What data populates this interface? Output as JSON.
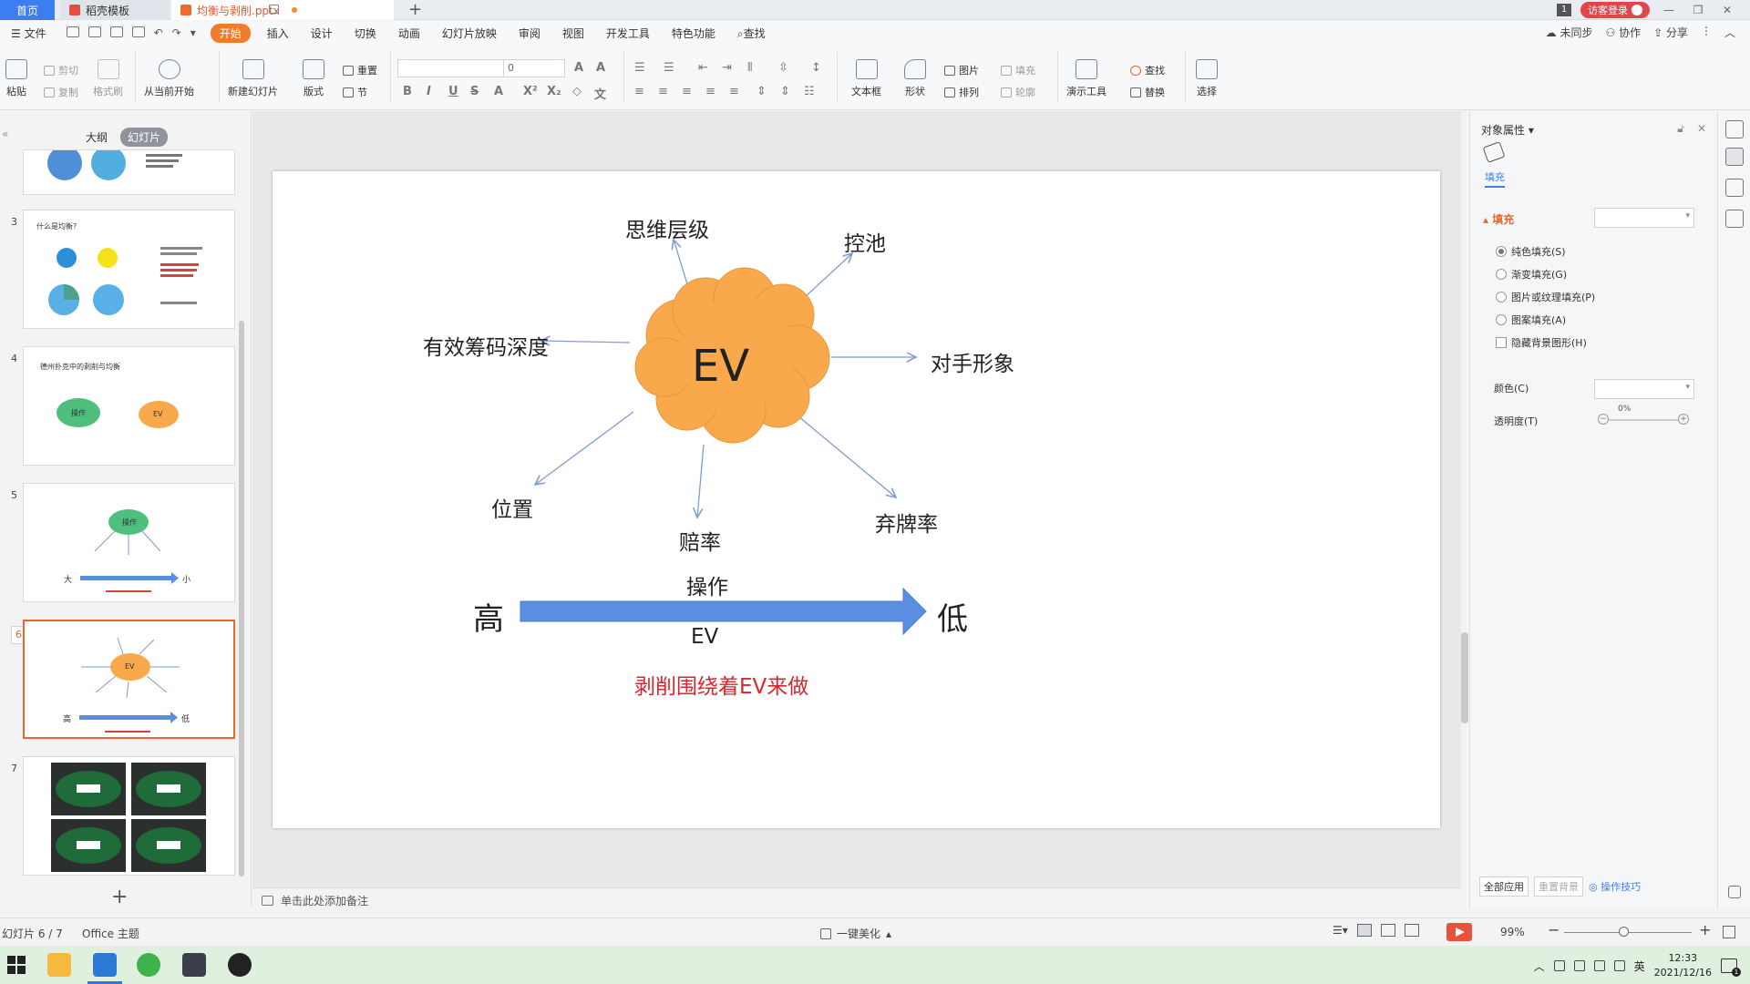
{
  "titlebar": {
    "tabs": [
      {
        "label": "首页"
      },
      {
        "label": "稻壳模板"
      },
      {
        "label": "均衡与剥削.pptx"
      }
    ],
    "page_badge": "1",
    "login_label": "访客登录"
  },
  "menubar": {
    "file_label": "文件",
    "items": [
      "开始",
      "插入",
      "设计",
      "切换",
      "动画",
      "幻灯片放映",
      "审阅",
      "视图",
      "开发工具",
      "特色功能",
      "查找"
    ],
    "right": [
      "未同步",
      "协作",
      "分享"
    ]
  },
  "ribbon": {
    "paste": "粘贴",
    "cut": "剪切",
    "copy": "复制",
    "format_painter": "格式刷",
    "from_current": "从当前开始",
    "new_slide": "新建幻灯片",
    "layout": "版式",
    "reset": "重置",
    "section": "节",
    "font_size": "0",
    "textbox": "文本框",
    "shape": "形状",
    "picture": "图片",
    "fill": "填充",
    "arrange": "排列",
    "outline": "轮廓",
    "present_tools": "演示工具",
    "find": "查找",
    "replace": "替换",
    "select": "选择"
  },
  "left_panel": {
    "tab_outline": "大纲",
    "tab_slides": "幻灯片",
    "slides": [
      {
        "num": "3",
        "title": "什么是均衡?"
      },
      {
        "num": "4",
        "title": "德州扑克中的剥削与均衡",
        "b1": "操作",
        "b2": "EV"
      },
      {
        "num": "5",
        "left": "大",
        "right": "小",
        "bubble": "操作"
      },
      {
        "num": "6",
        "left": "高",
        "right": "低",
        "bubble": "EV"
      },
      {
        "num": "7"
      }
    ]
  },
  "slide": {
    "center": "EV",
    "nodes": {
      "top": "思维层级",
      "top_right": "控池",
      "left": "有效筹码深度",
      "right": "对手形象",
      "bottom_left": "位置",
      "bottom": "赔率",
      "bottom_right": "弃牌率"
    },
    "arrow_top_label": "操作",
    "arrow_bottom_label": "EV",
    "arrow_left": "高",
    "arrow_right": "低",
    "caption": "剥削围绕着EV来做",
    "colors": {
      "cloud": "#F9A94B",
      "arrow": "#5B8DE0",
      "caption": "#D7262E",
      "connector": "#7F9CD0"
    }
  },
  "notes_placeholder": "单击此处添加备注",
  "right_panel": {
    "title": "对象属性",
    "tab_fill": "填充",
    "section": "填充",
    "options": [
      "纯色填充(S)",
      "渐变填充(G)",
      "图片或纹理填充(P)",
      "图案填充(A)",
      "隐藏背景图形(H)"
    ],
    "color_label": "颜色(C)",
    "transparency_label": "透明度(T)",
    "transparency_value": "0%",
    "apply_all": "全部应用",
    "reset_bg": "重置背景",
    "tips": "操作技巧"
  },
  "statusbar": {
    "slide_pos": "幻灯片 6 / 7",
    "theme": "Office 主题",
    "beautify": "一键美化",
    "zoom": "99%"
  },
  "taskbar": {
    "time": "12:33",
    "date": "2021/12/16",
    "ime": "英",
    "notif_count": "1"
  }
}
